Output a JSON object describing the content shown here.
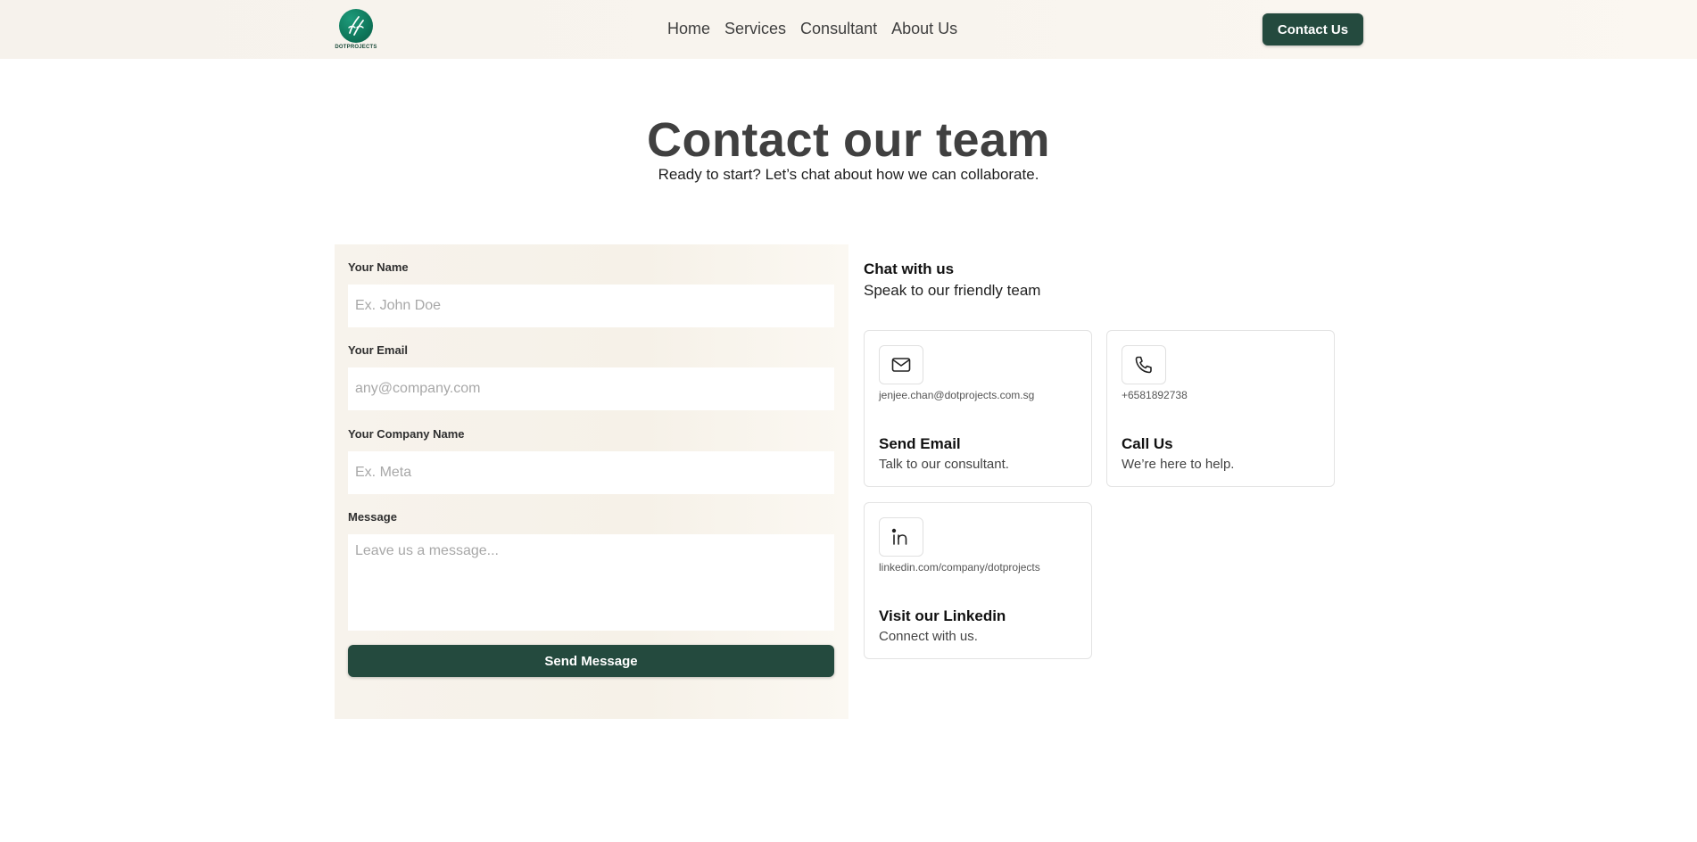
{
  "header": {
    "logo_text": "DOTPROJECTS",
    "nav": [
      "Home",
      "Services",
      "Consultant",
      "About Us"
    ],
    "cta_label": "Contact Us"
  },
  "hero": {
    "title": "Contact our team",
    "subtitle": "Ready to start? Let’s chat about how we can collaborate."
  },
  "form": {
    "name_label": "Your Name",
    "name_placeholder": "Ex. John Doe",
    "email_label": "Your Email",
    "email_placeholder": "any@company.com",
    "company_label": "Your Company Name",
    "company_placeholder": "Ex. Meta",
    "message_label": "Message",
    "message_placeholder": "Leave us a message...",
    "submit_label": "Send Message"
  },
  "contact": {
    "title": "Chat with us",
    "subtitle": "Speak to our friendly team",
    "cards": [
      {
        "icon": "mail-icon",
        "detail": "jenjee.chan@dotprojects.com.sg",
        "title": "Send Email",
        "subtitle": "Talk to our consultant."
      },
      {
        "icon": "phone-icon",
        "detail": "+6581892738",
        "title": "Call Us",
        "subtitle": "We’re here to help."
      },
      {
        "icon": "linkedin-icon",
        "detail": "linkedin.com/company/dotprojects",
        "title": "Visit our Linkedin",
        "subtitle": "Connect with us."
      }
    ]
  },
  "colors": {
    "accent": "#244a3e",
    "header_bg": "#f8f4ee",
    "form_bg": "#f6f1e8",
    "logo_green": "#0f7a5d"
  }
}
